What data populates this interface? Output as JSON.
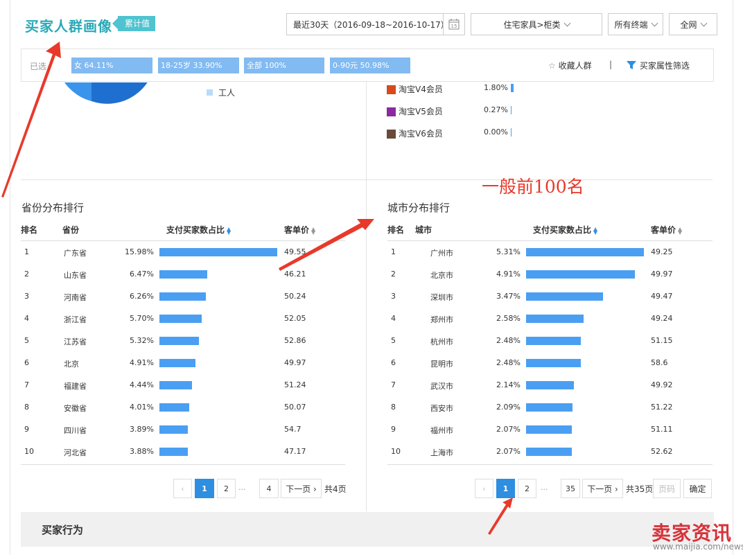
{
  "header": {
    "title": "买家人群画像",
    "tag": "累计值",
    "date_range": "最近30天（2016-09-18~2016-10-17）",
    "calendar_day": "15",
    "category": "住宅家具>柜类",
    "terminal": "所有终端",
    "network": "全网"
  },
  "filter_bar": {
    "selected_label": "已选",
    "chips": [
      "女 64.11%",
      "18-25岁 33.90%",
      "全部 100%",
      "0-90元 50.98%"
    ],
    "favorite_label": "收藏人群",
    "divider": "|",
    "attr_filter_label": "买家属性筛选"
  },
  "upper": {
    "legend_item": "工人",
    "vip_rows": [
      {
        "label": "淘宝V4会员",
        "value": "1.80%",
        "color": "#d84a1b"
      },
      {
        "label": "淘宝V5会员",
        "value": "0.27%",
        "color": "#8a2aa0"
      },
      {
        "label": "淘宝V6会员",
        "value": "0.00%",
        "color": "#6a4a3a"
      }
    ]
  },
  "province": {
    "title": "省份分布排行",
    "headers": {
      "rank": "排名",
      "name": "省份",
      "ratio": "支付买家数占比",
      "price": "客单价"
    },
    "rows": [
      {
        "rank": "1",
        "name": "广东省",
        "ratio": "15.98%",
        "value": 15.98,
        "price": "49.55"
      },
      {
        "rank": "2",
        "name": "山东省",
        "ratio": "6.47%",
        "value": 6.47,
        "price": "46.21"
      },
      {
        "rank": "3",
        "name": "河南省",
        "ratio": "6.26%",
        "value": 6.26,
        "price": "50.24"
      },
      {
        "rank": "4",
        "name": "浙江省",
        "ratio": "5.70%",
        "value": 5.7,
        "price": "52.05"
      },
      {
        "rank": "5",
        "name": "江苏省",
        "ratio": "5.32%",
        "value": 5.32,
        "price": "52.86"
      },
      {
        "rank": "6",
        "name": "北京",
        "ratio": "4.91%",
        "value": 4.91,
        "price": "49.97"
      },
      {
        "rank": "7",
        "name": "福建省",
        "ratio": "4.44%",
        "value": 4.44,
        "price": "51.24"
      },
      {
        "rank": "8",
        "name": "安徽省",
        "ratio": "4.01%",
        "value": 4.01,
        "price": "50.07"
      },
      {
        "rank": "9",
        "name": "四川省",
        "ratio": "3.89%",
        "value": 3.89,
        "price": "54.7"
      },
      {
        "rank": "10",
        "name": "河北省",
        "ratio": "3.88%",
        "value": 3.88,
        "price": "47.17"
      }
    ],
    "pager": {
      "prev": "‹",
      "pages": [
        "1",
        "2",
        "...",
        "4"
      ],
      "next": "下一页 ›",
      "total": "共4页"
    }
  },
  "city": {
    "title": "城市分布排行",
    "headers": {
      "rank": "排名",
      "name": "城市",
      "ratio": "支付买家数占比",
      "price": "客单价"
    },
    "rows": [
      {
        "rank": "1",
        "name": "广州市",
        "ratio": "5.31%",
        "value": 5.31,
        "price": "49.25"
      },
      {
        "rank": "2",
        "name": "北京市",
        "ratio": "4.91%",
        "value": 4.91,
        "price": "49.97"
      },
      {
        "rank": "3",
        "name": "深圳市",
        "ratio": "3.47%",
        "value": 3.47,
        "price": "49.47"
      },
      {
        "rank": "4",
        "name": "郑州市",
        "ratio": "2.58%",
        "value": 2.58,
        "price": "49.24"
      },
      {
        "rank": "5",
        "name": "杭州市",
        "ratio": "2.48%",
        "value": 2.48,
        "price": "51.15"
      },
      {
        "rank": "6",
        "name": "昆明市",
        "ratio": "2.48%",
        "value": 2.48,
        "price": "58.6"
      },
      {
        "rank": "7",
        "name": "武汉市",
        "ratio": "2.14%",
        "value": 2.14,
        "price": "49.92"
      },
      {
        "rank": "8",
        "name": "西安市",
        "ratio": "2.09%",
        "value": 2.09,
        "price": "51.22"
      },
      {
        "rank": "9",
        "name": "福州市",
        "ratio": "2.07%",
        "value": 2.07,
        "price": "51.11"
      },
      {
        "rank": "10",
        "name": "上海市",
        "ratio": "2.07%",
        "value": 2.07,
        "price": "52.62"
      }
    ],
    "pager": {
      "prev": "‹",
      "pages": [
        "1",
        "2",
        "...",
        "35"
      ],
      "next": "下一页 ›",
      "total": "共35页",
      "page_input": "页码",
      "confirm": "确定"
    }
  },
  "annotation": "一般前100名",
  "behavior_title": "买家行为",
  "watermark": {
    "brand": "卖家资讯",
    "url": "www.maijia.com/news"
  },
  "colors": {
    "accent": "#2aa9b6",
    "bar": "#4a9ff2",
    "chip": "#82baf2",
    "arrow": "#e8392b"
  }
}
